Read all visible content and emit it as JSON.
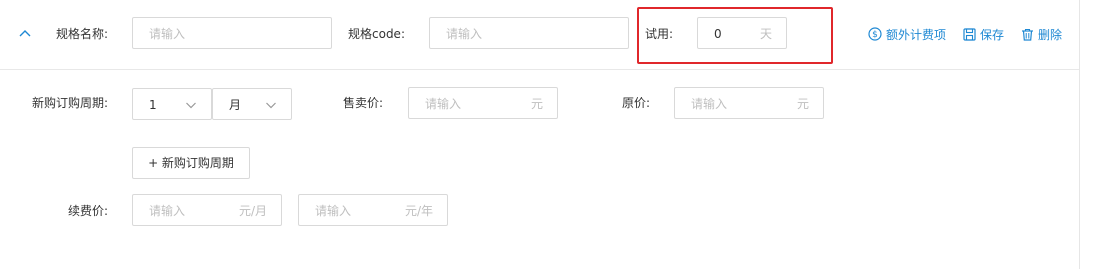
{
  "spec_header": {
    "spec_name_label": "规格名称:",
    "spec_name_placeholder": "请输入",
    "spec_code_label": "规格code:",
    "spec_code_placeholder": "请输入",
    "trial_label": "试用:",
    "trial_value": "0",
    "trial_unit": "天",
    "actions": {
      "extra_fee": "额外计费项",
      "save": "保存",
      "delete": "删除"
    }
  },
  "purchase": {
    "period_label": "新购订购周期:",
    "period_value": "1",
    "period_unit": "月",
    "sale_price_label": "售卖价:",
    "sale_price_placeholder": "请输入",
    "sale_price_unit": "元",
    "original_price_label": "原价:",
    "original_price_placeholder": "请输入",
    "original_price_unit": "元",
    "add_period_button": "+ 新购订购周期"
  },
  "renewal": {
    "label": "续费价:",
    "monthly_placeholder": "请输入",
    "monthly_unit": "元/月",
    "yearly_placeholder": "请输入",
    "yearly_unit": "元/年"
  },
  "colors": {
    "accent": "#1e88d3",
    "highlight_border": "#e0272b",
    "input_border": "#d9d9d9",
    "placeholder": "#bfbfbf"
  }
}
